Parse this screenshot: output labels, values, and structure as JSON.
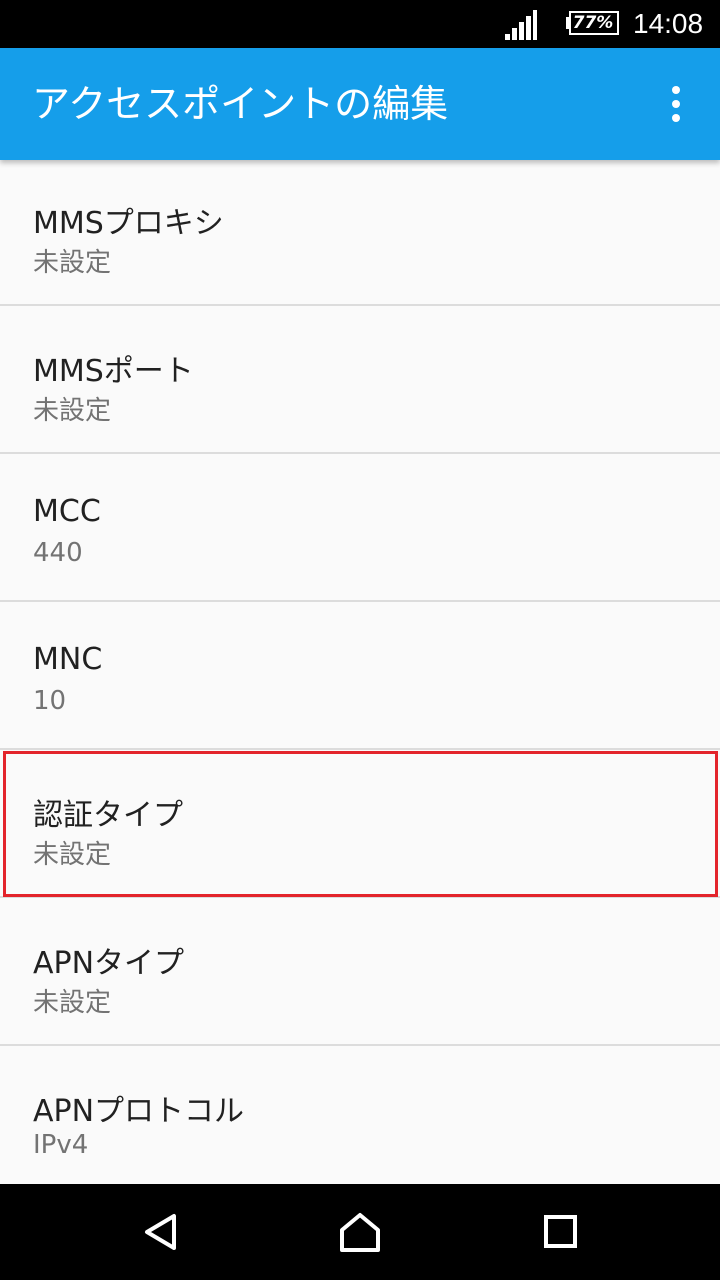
{
  "status_bar": {
    "battery": "77%",
    "time": "14:08",
    "icons": [
      "signal-icon",
      "battery-icon"
    ]
  },
  "app_bar": {
    "title": "アクセスポイントの編集",
    "menu_icon": "overflow-menu-icon"
  },
  "settings": [
    {
      "title": "MMSプロキシ",
      "summary": "未設定"
    },
    {
      "title": "MMSポート",
      "summary": "未設定"
    },
    {
      "title": "MCC",
      "summary": "440"
    },
    {
      "title": "MNC",
      "summary": "10"
    },
    {
      "title": "認証タイプ",
      "summary": "未設定"
    },
    {
      "title": "APNタイプ",
      "summary": "未設定"
    },
    {
      "title": "APNプロトコル",
      "summary": "IPv4"
    }
  ],
  "nav_bar": {
    "icons": [
      "back-icon",
      "home-icon",
      "recents-icon"
    ]
  },
  "colors": {
    "app_bar": "#159eea",
    "highlight": "#e3242b"
  }
}
